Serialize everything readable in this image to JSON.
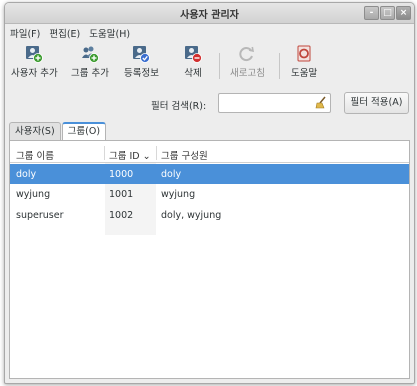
{
  "window": {
    "title": "사용자 관리자",
    "controls": [
      "-",
      "□",
      "×"
    ]
  },
  "menu": [
    "파일(F)",
    "편집(E)",
    "도움말(H)"
  ],
  "toolbar": {
    "add_user": "사용자 추가",
    "add_group": "그룹 추가",
    "properties": "등록정보",
    "delete": "삭제",
    "refresh": "새로고침",
    "help": "도움말"
  },
  "filter": {
    "label": "필터 검색(R):",
    "value": "",
    "apply": "필터 적용(A)"
  },
  "tabs": [
    "사용자(S)",
    "그룹(O)"
  ],
  "table": {
    "columns": [
      "그룹 이름",
      "그룹 ID",
      "그룹 구성원"
    ],
    "sort_indicator": "⌄",
    "rows": [
      {
        "name": "doly",
        "id": "1000",
        "members": "doly",
        "selected": true
      },
      {
        "name": "wyjung",
        "id": "1001",
        "members": "wyjung",
        "selected": false
      },
      {
        "name": "superuser",
        "id": "1002",
        "members": "doly, wyjung",
        "selected": false
      }
    ]
  },
  "colors": {
    "selection": "#4a90d9",
    "window_bg": "#ededed"
  }
}
